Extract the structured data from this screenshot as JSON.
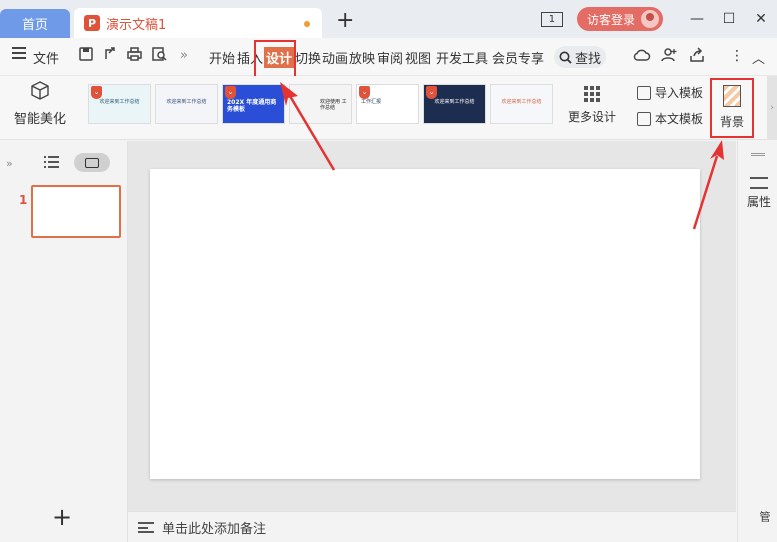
{
  "titlebar": {
    "home_tab": "首页",
    "doc_icon_letter": "P",
    "doc_title": "演示文稿1",
    "new_tab": "+",
    "page_indicator": "1",
    "login_label": "访客登录",
    "minimize": "—",
    "maximize": "☐",
    "close": "✕"
  },
  "menu": {
    "file": "文件",
    "more": "»",
    "tabs": [
      "开始",
      "插入",
      "设计",
      "切换",
      "动画",
      "放映",
      "审阅",
      "视图",
      "开发工具",
      "会员专享"
    ],
    "active_tab": "设计",
    "search": "查找",
    "menu_more": "⋮",
    "collapse": "︿"
  },
  "ribbon": {
    "smart_beautify": "智能美化",
    "templates": [
      {
        "bg": "#eaf5f8",
        "text": "欢迎来到工作总结",
        "color": "#2e5d7a"
      },
      {
        "bg": "#f3f5f8",
        "text": "欢迎来到工作总结",
        "color": "#3b4f7a"
      },
      {
        "bg": "#2a4fd6",
        "text": "202X 年度通用商务模板",
        "color": "#ffffff"
      },
      {
        "bg": "#f4f4f4",
        "text": "欢迎使用 工作总结",
        "color": "#222222"
      },
      {
        "bg": "#ffffff",
        "text": "工作汇报",
        "color": "#1f3b5e"
      },
      {
        "bg": "#1d2d4f",
        "text": "欢迎来到工作总结",
        "color": "#ffffff"
      },
      {
        "bg": "#f5f7fb",
        "text": "欢迎来到工作总结",
        "color": "#d46a4a"
      }
    ],
    "more_design": "更多设计",
    "import_template": "导入模板",
    "this_template": "本文模板",
    "background": "背景"
  },
  "left_panel": {
    "expand": "»",
    "slide_number": "1",
    "add_slide": "+"
  },
  "notes": {
    "placeholder": "单击此处添加备注"
  },
  "right_panel": {
    "properties": "属性",
    "bottom_label": "管"
  },
  "colors": {
    "accent": "#e0523a",
    "home_tab": "#6f9ae8",
    "highlight_box": "#e53333"
  }
}
